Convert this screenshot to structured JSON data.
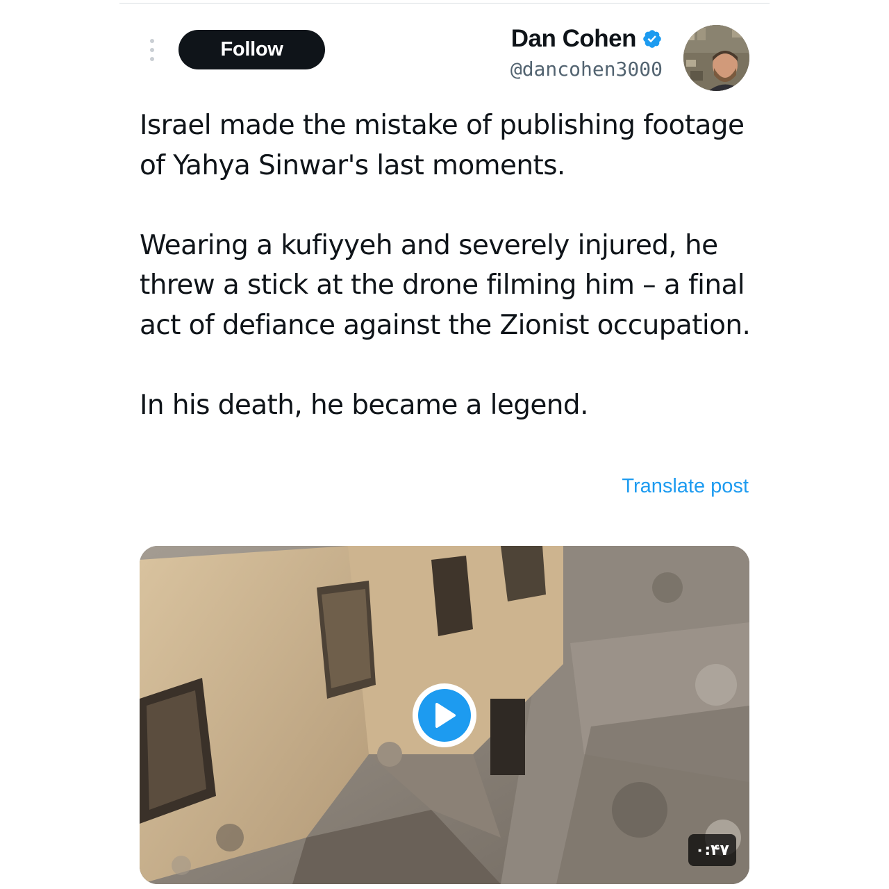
{
  "tweet": {
    "author": {
      "display_name": "Dan Cohen",
      "handle": "@dancohen3000",
      "verified": true,
      "verified_color": "#1d9bf0"
    },
    "actions": {
      "follow_label": "Follow",
      "more_icon": "more-vertical-icon"
    },
    "text": {
      "paragraph_1": "Israel made the mistake of publishing footage of Yahya Sinwar's last moments.",
      "paragraph_2": "Wearing a kufiyyeh and severely injured, he threw a stick at the drone filming him – a final act of defiance against the Zionist occupation.",
      "paragraph_3": "In his death, he became a legend."
    },
    "translate_label": "Translate post",
    "media": {
      "type": "video",
      "duration": "۰:۴۷",
      "play_icon": "play-icon"
    }
  },
  "colors": {
    "text_primary": "#0f1419",
    "text_secondary": "#536471",
    "accent": "#1d9bf0",
    "follow_bg": "#0f1419"
  }
}
